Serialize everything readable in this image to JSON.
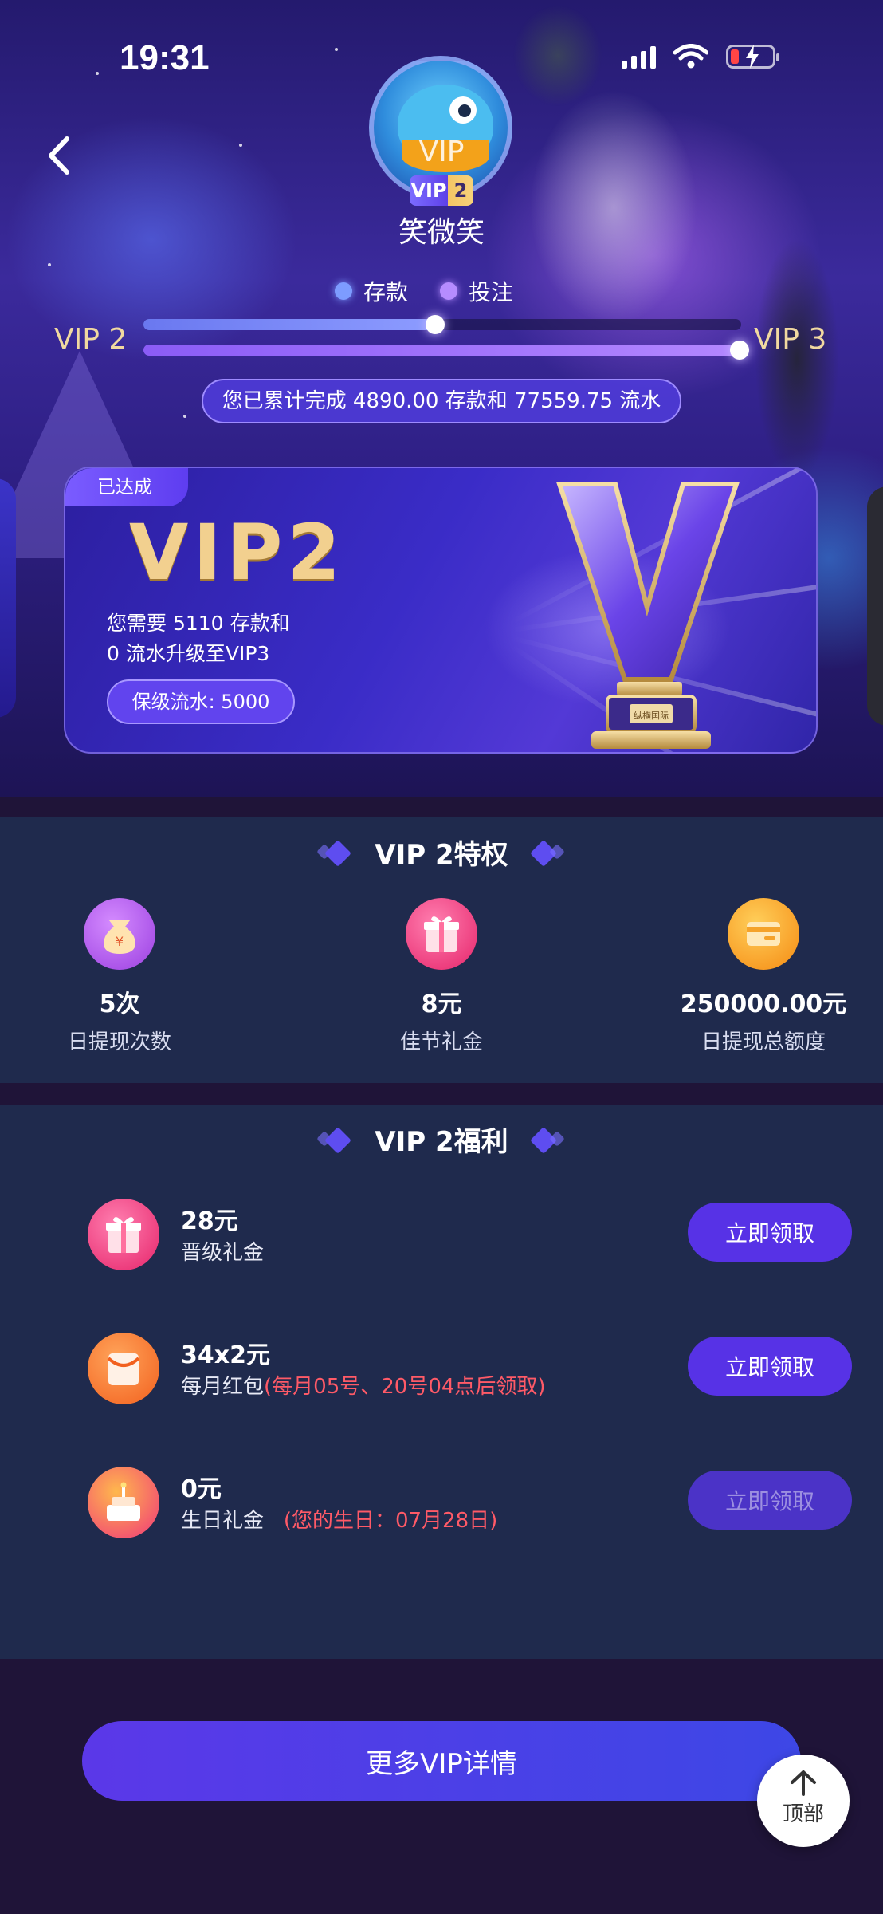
{
  "status_bar": {
    "time": "19:31"
  },
  "header": {
    "vip_label": "VIP",
    "badge": {
      "prefix": "VIP",
      "level": "2"
    },
    "username": "笑微笑"
  },
  "progress": {
    "legend": {
      "deposit": "存款",
      "bet": "投注"
    },
    "current_level": "VIP 2",
    "next_level": "VIP 3",
    "deposit_fraction": 0.49,
    "bet_fraction": 1.0,
    "summary": "您已累计完成 4890.00 存款和 77559.75 流水"
  },
  "vip_card": {
    "tag": "已达成",
    "level_title": "VIP2",
    "requirement_line1": "您需要 5110 存款和",
    "requirement_line2": "0 流水升级至VIP3",
    "keep_turnover": "保级流水: 5000",
    "trophy_plaque": "纵横国际"
  },
  "privileges": {
    "title": "VIP 2特权",
    "items": [
      {
        "value": "5次",
        "label": "日提现次数",
        "icon": "money-bag-icon"
      },
      {
        "value": "8元",
        "label": "佳节礼金",
        "icon": "gift-icon"
      },
      {
        "value": "250000.00元",
        "label": "日提现总额度",
        "icon": "card-icon"
      }
    ]
  },
  "benefits": {
    "title": "VIP 2福利",
    "items": [
      {
        "amount": "28元",
        "desc": "晋级礼金",
        "note": "",
        "button": "立即领取",
        "enabled": true,
        "icon": "gift-icon"
      },
      {
        "amount": "34x2元",
        "desc": "每月红包",
        "note": "(每月05号、20号04点后领取)",
        "button": "立即领取",
        "enabled": true,
        "icon": "red-envelope-icon"
      },
      {
        "amount": "0元",
        "desc": "生日礼金",
        "note": "(您的生日：07月28日)",
        "button": "立即领取",
        "enabled": false,
        "icon": "birthday-cake-icon"
      }
    ]
  },
  "footer": {
    "more_button": "更多VIP详情",
    "top_button": "顶部"
  },
  "colors": {
    "accent": "#5732e6",
    "gold": "#f2d08f",
    "note_red": "#ff5a67",
    "panel": "#1f2a4d",
    "page": "#1f1438"
  }
}
